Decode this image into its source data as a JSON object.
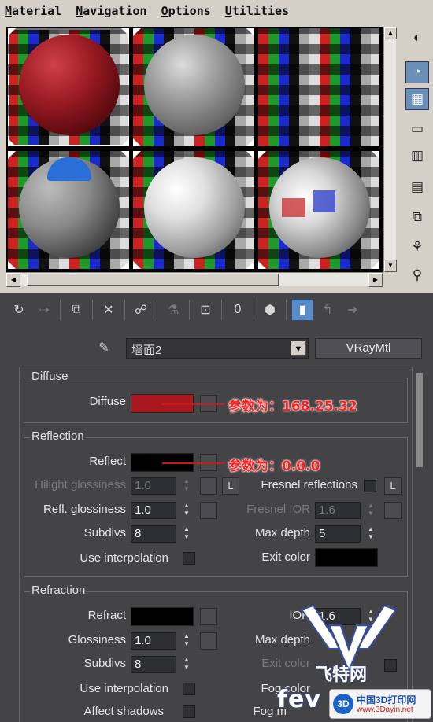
{
  "menu": [
    "Material",
    "Navigation",
    "Options",
    "Utilities"
  ],
  "slot_icons": [
    "sample-sphere-icon",
    "backlight-icon",
    "background-checker-icon",
    "uv-tiling-icon",
    "video-color-check-icon",
    "make-preview-icon",
    "options-icon",
    "select-by-material-icon",
    "material-map-navigator-icon"
  ],
  "toolbar": {
    "icons": [
      "get-material-icon",
      "put-to-scene-icon",
      "assign-material-icon",
      "reset-map-icon",
      "make-unique-icon",
      "put-to-library-icon",
      "material-id-channel-icon",
      "show-map-in-viewport-icon",
      "show-end-result-icon",
      "go-to-parent-icon",
      "go-forward-to-sibling-icon"
    ],
    "material_id_label": "0"
  },
  "material": {
    "name": "墙面2",
    "type": "VRayMtl"
  },
  "diffuse": {
    "title": "Diffuse",
    "label": "Diffuse",
    "color": "#a8191f",
    "annotation": "参数为：168.25.32"
  },
  "reflection": {
    "title": "Reflection",
    "reflect_label": "Reflect",
    "reflect_color": "#000000",
    "annotation": "参数为：0.0.0",
    "hilight_label": "Hilight glossiness",
    "hilight_value": "1.0",
    "lock_label": "L",
    "fresnel_label": "Fresnel reflections",
    "fresnel_lock_label": "L",
    "refl_gloss_label": "Refl. glossiness",
    "refl_gloss_value": "1.0",
    "fresnel_ior_label": "Fresnel IOR",
    "fresnel_ior_value": "1.6",
    "subdivs_label": "Subdivs",
    "subdivs_value": "8",
    "max_depth_label": "Max depth",
    "max_depth_value": "5",
    "use_interp_label": "Use interpolation",
    "exit_color_label": "Exit color",
    "exit_color": "#000000"
  },
  "refraction": {
    "title": "Refraction",
    "refract_label": "Refract",
    "refract_color": "#000000",
    "ior_label": "IOR",
    "ior_value": "1.6",
    "gloss_label": "Glossiness",
    "gloss_value": "1.0",
    "max_depth_label": "Max depth",
    "subdivs_label": "Subdivs",
    "subdivs_value": "8",
    "exit_color_label": "Exit color",
    "use_interp_label": "Use interpolation",
    "fog_color_label": "Fog color",
    "affect_shadows_label": "Affect shadows",
    "fog_mult_label": "Fog m"
  },
  "watermark": {
    "cn": "飞特网",
    "en": "fev",
    "logo_cn": "中国3D打印网",
    "logo_url": "www.3Dayin.net"
  }
}
